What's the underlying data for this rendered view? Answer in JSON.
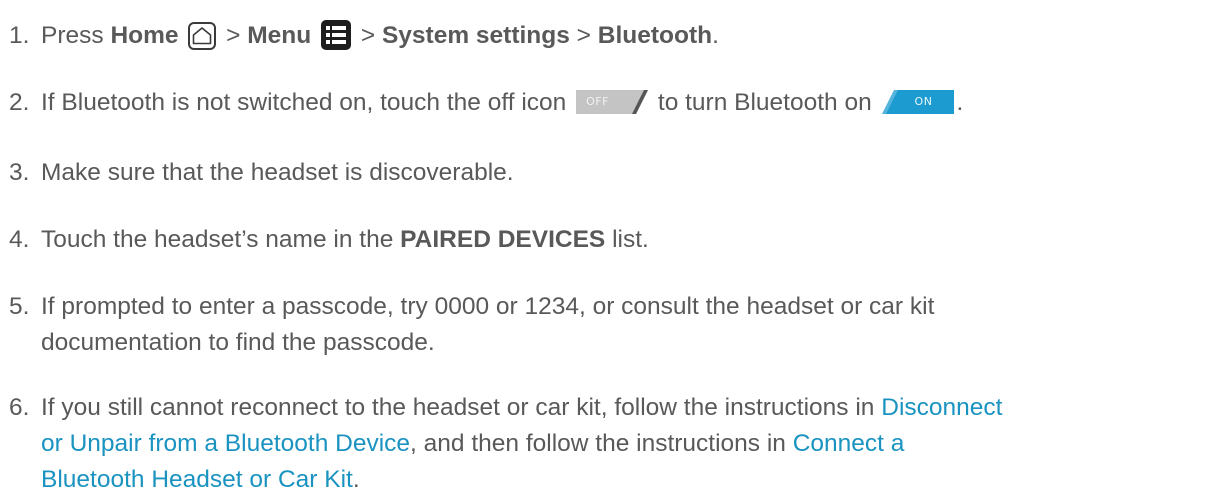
{
  "steps": [
    {
      "num": "1.",
      "pre": "Press ",
      "home": "Home",
      "sep1": " > ",
      "menu": "Menu",
      "sep2": " > ",
      "system_settings": "System settings",
      "sep3": " > ",
      "bluetooth": "Bluetooth",
      "end": "."
    },
    {
      "num": "2.",
      "pre": "If Bluetooth is not switched on, touch the off icon ",
      "off_label": "OFF",
      "mid": " to turn Bluetooth on ",
      "on_label": "ON",
      "end": "."
    },
    {
      "num": "3.",
      "text": "Make sure that the headset is discoverable."
    },
    {
      "num": "4.",
      "pre": "Touch the headset’s name in the ",
      "bold": "PAIRED DEVICES",
      "post": " list."
    },
    {
      "num": "5.",
      "line1": "If prompted to enter a passcode, try 0000 or 1234, or consult the headset or car kit",
      "line2": "documentation to find the passcode."
    },
    {
      "num": "6.",
      "line1_pre": "If you still cannot reconnect to the headset or car kit, follow the instructions in ",
      "link1_part1": "Disconnect",
      "link1_part2": "or Unpair from a Bluetooth Device",
      "line2_mid": ", and then follow the instructions in ",
      "link2_part1": "Connect a",
      "link2_part2": "Bluetooth Headset or Car Kit",
      "end": "."
    }
  ],
  "icons": {
    "home": "home-icon",
    "menu": "menu-icon",
    "toggle_off": "toggle-off-icon",
    "toggle_on": "toggle-on-icon"
  },
  "colors": {
    "text": "#595959",
    "link": "#1a93c1",
    "toggle_on_accent": "#1c9bd0",
    "toggle_off_bg": "#c9c9c9"
  }
}
